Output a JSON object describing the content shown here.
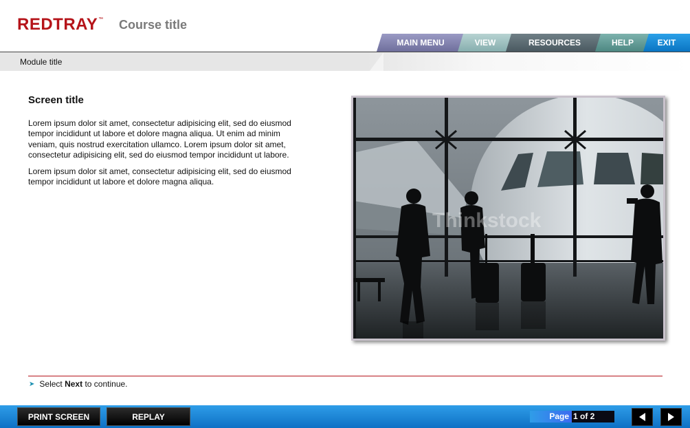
{
  "header": {
    "logo": "REDTRAY",
    "logo_tm": "™",
    "course_title": "Course title"
  },
  "nav": {
    "main_menu": "MAIN MENU",
    "view": "VIEW",
    "resources": "RESOURCES",
    "help": "HELP",
    "exit": "EXIT"
  },
  "module": {
    "title": "Module title"
  },
  "content": {
    "screen_title": "Screen title",
    "paragraph_1": "Lorem ipsum dolor sit amet, consectetur adipisicing elit, sed do eiusmod tempor incididunt ut labore et dolore magna aliqua. Ut enim ad minim veniam, quis nostrud exercitation ullamco. Lorem ipsum dolor sit amet, consectetur adipisicing elit, sed do eiusmod tempor incididunt ut labore.",
    "paragraph_2": "Lorem ipsum dolor sit amet, consectetur adipisicing elit, sed do eiusmod tempor incididunt ut labore et dolore magna aliqua.",
    "image_watermark": "Thinkstock"
  },
  "instruction": {
    "prefix": "Select",
    "keyword": "Next",
    "suffix": "to continue."
  },
  "footer": {
    "print_label": "PRINT SCREEN",
    "replay_label": "REPLAY",
    "page_label": "Page",
    "page_value": "1 of 2"
  },
  "colors": {
    "brand_red": "#b5141a",
    "footer_blue": "#0e70c4",
    "exit_blue": "#0a74c2"
  }
}
